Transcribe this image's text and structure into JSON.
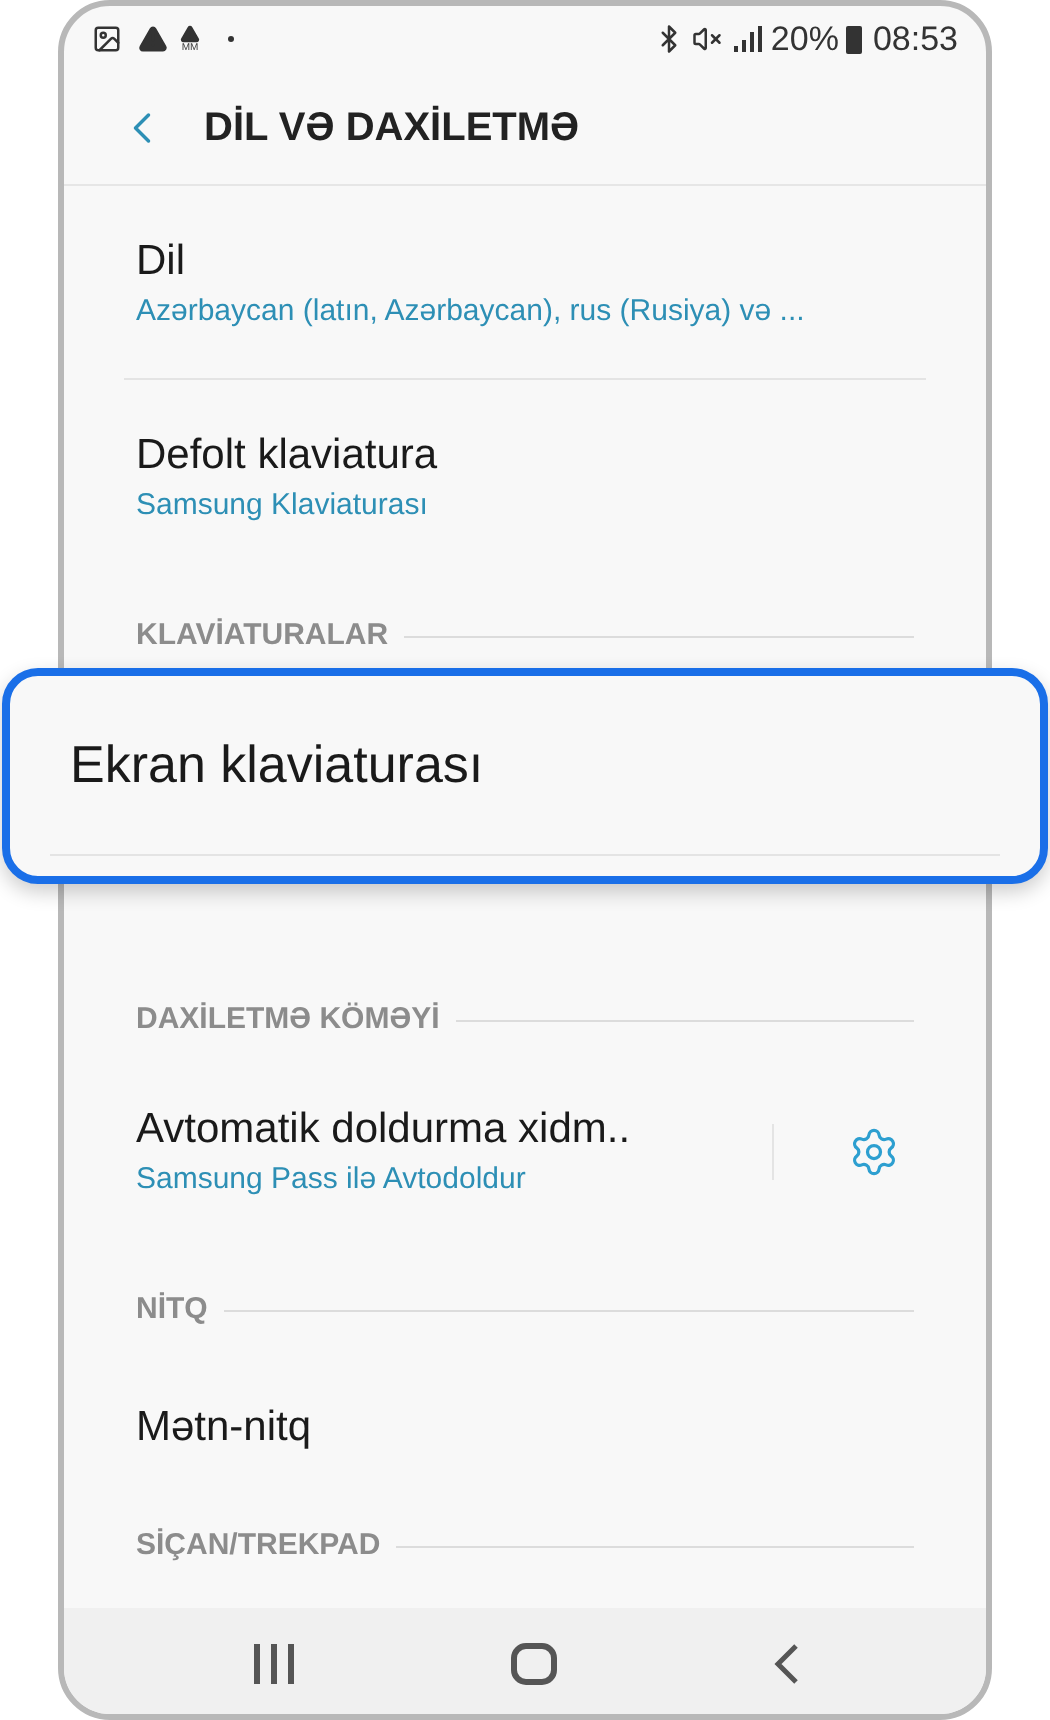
{
  "status_bar": {
    "badge": "MM",
    "battery": "20%",
    "time": "08:53"
  },
  "header": {
    "title": "DİL VƏ DAXİLETMƏ"
  },
  "sections": [
    {
      "items": [
        {
          "title": "Dil",
          "subtitle": "Azərbaycan (latın, Azərbaycan), rus (Rusiya) və ...",
          "divider": true
        },
        {
          "title": "Defolt klaviatura",
          "subtitle": "Samsung Klaviaturası"
        }
      ]
    },
    {
      "header": "KLAVİATURALAR"
    },
    {
      "header": "DAXİLETMƏ KÖMƏYİ",
      "items": [
        {
          "title": "Avtomatik doldurma xidm..",
          "subtitle": "Samsung Pass ilə Avtodoldur",
          "settings": true
        }
      ]
    },
    {
      "header": "NİTQ",
      "items": [
        {
          "title": "Mətn-nitq"
        }
      ]
    },
    {
      "header": "SİÇAN/TREKPAD"
    }
  ],
  "callout": {
    "label": "Ekran klaviaturası"
  }
}
